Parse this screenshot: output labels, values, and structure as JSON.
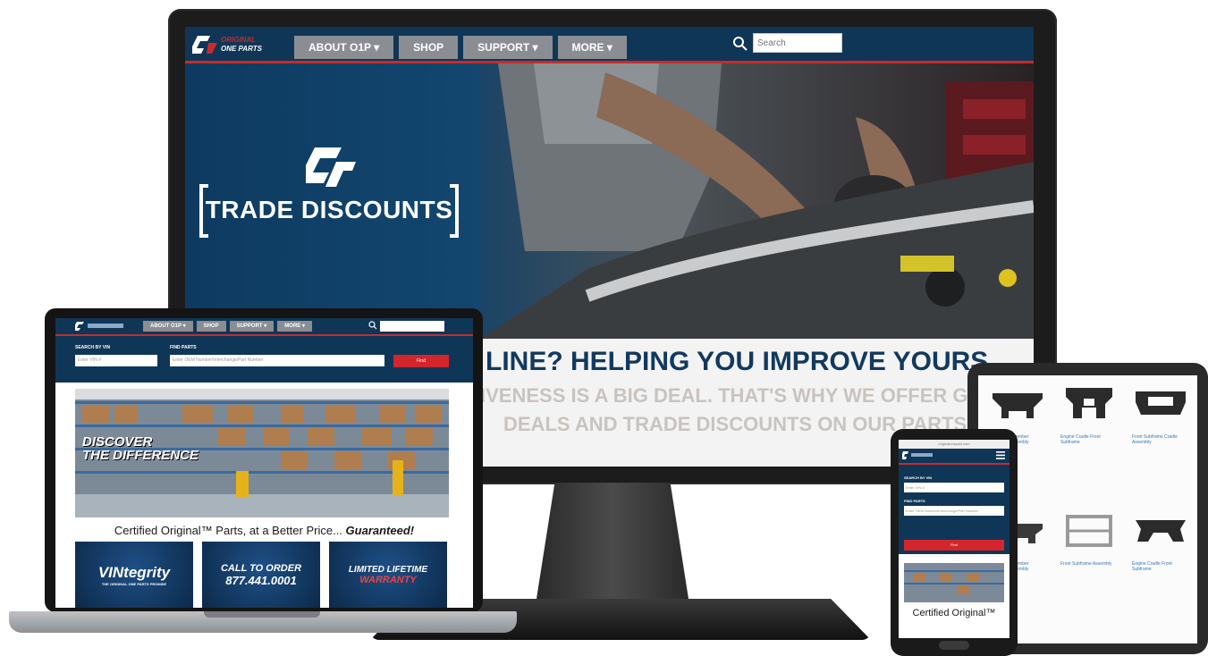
{
  "monitor": {
    "brand_line1": "ORIGINAL",
    "brand_line2": "ONE PARTS",
    "nav": [
      "ABOUT O1P ▾",
      "SHOP",
      "SUPPORT ▾",
      "MORE ▾"
    ],
    "search_placeholder": "Search",
    "hero_title": "TRADE DISCOUNTS",
    "headline": "LINE? HELPING YOU IMPROVE YOURS",
    "sub_line1": "IVENESS IS A BIG DEAL. THAT'S WHY WE OFFER GR",
    "sub_line2": "DEALS AND TRADE DISCOUNTS ON OUR PARTS."
  },
  "laptop": {
    "nav": [
      "ABOUT O1P ▾",
      "SHOP",
      "SUPPORT ▾",
      "MORE ▾"
    ],
    "search_vin_label": "SEARCH BY VIN",
    "search_vin_placeholder": "Enter VIN #",
    "find_parts_label": "FIND PARTS",
    "find_parts_placeholder": "Enter OEM Number/Interchange/Part Number",
    "find_button": "Find",
    "banner_line1": "DISCOVER",
    "banner_line2": "THE DIFFERENCE",
    "certified_text": "Certified Original™ Parts, at a Better Price...",
    "certified_emphasis": "Guaranteed!",
    "cards": [
      {
        "title": "VINtegrity",
        "sub": "THE ORIGINAL ONE PARTS PROMISE"
      },
      {
        "title": "CALL TO ORDER",
        "sub": "877.441.0001"
      },
      {
        "title": "LIMITED LIFETIME",
        "sub": "WARRANTY"
      }
    ]
  },
  "tablet": {
    "products": [
      {
        "link": "Front Crossmember Subframe Assembly"
      },
      {
        "link": "Engine Cradle Front Subframe"
      },
      {
        "link": "Front Subframe Cradle Assembly"
      },
      {
        "link": "Front Crossmember Subframe Assembly"
      },
      {
        "link": "Front Subframe Assembly"
      },
      {
        "link": "Engine Cradle Front Subframe"
      }
    ]
  },
  "phone": {
    "url": "originalonepart.com",
    "search_vin_label": "SEARCH BY VIN",
    "search_vin_placeholder": "Enter VIN #",
    "find_parts_label": "FIND PARTS",
    "find_parts_placeholder": "Enter OEM Number/Interchange/Part Number",
    "find_button": "Find",
    "certified_text": "Certified Original™"
  },
  "colors": {
    "navy": "#0f3657",
    "accent_red": "#c92a2a",
    "nav_gray": "#8a8e93"
  }
}
